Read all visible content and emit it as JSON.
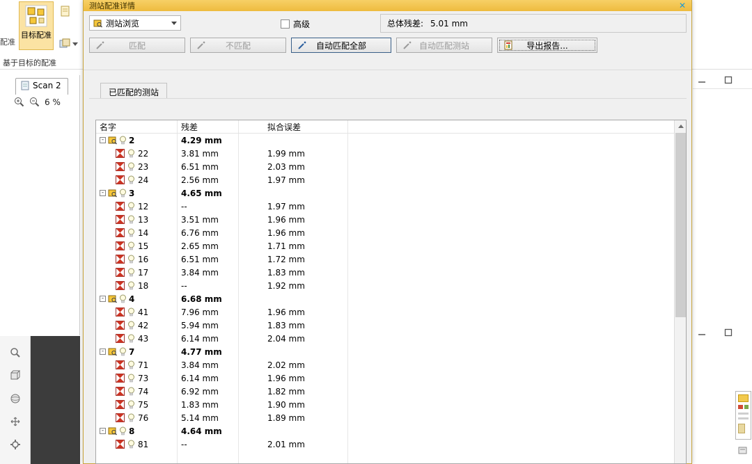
{
  "app": {
    "toolbar": {
      "partial_label": "配准",
      "target_registration_label": "目标配准",
      "target_based_label": "基于目标的配准"
    },
    "left_panel": {
      "tab_label": "Scan 2",
      "zoom_value": "6 %"
    }
  },
  "dialog": {
    "title": "测站配准详情",
    "close_glyph": "✕",
    "station_view_dropdown": "测站浏览",
    "advanced_label": "高级",
    "overall_residual_label": "总体残差:",
    "overall_residual_value": "5.01 mm",
    "buttons": {
      "match": "匹配",
      "unmatch": "不匹配",
      "auto_match_all": "自动匹配全部",
      "auto_match_station": "自动匹配测站",
      "export_report": "导出报告..."
    },
    "section_tab": "已匹配的测站",
    "table": {
      "columns": [
        "名字",
        "残差",
        "拟合误差"
      ],
      "collapse_glyph": "-",
      "rows": [
        {
          "type": "group",
          "name": "2",
          "residual": "4.29 mm",
          "fit": ""
        },
        {
          "type": "item",
          "name": "22",
          "residual": "3.81 mm",
          "fit": "1.99 mm"
        },
        {
          "type": "item",
          "name": "23",
          "residual": "6.51 mm",
          "fit": "2.03 mm"
        },
        {
          "type": "item",
          "name": "24",
          "residual": "2.56 mm",
          "fit": "1.97 mm"
        },
        {
          "type": "group",
          "name": "3",
          "residual": "4.65 mm",
          "fit": ""
        },
        {
          "type": "item",
          "name": "12",
          "residual": "--",
          "fit": "1.97 mm"
        },
        {
          "type": "item",
          "name": "13",
          "residual": "3.51 mm",
          "fit": "1.96 mm"
        },
        {
          "type": "item",
          "name": "14",
          "residual": "6.76 mm",
          "fit": "1.96 mm"
        },
        {
          "type": "item",
          "name": "15",
          "residual": "2.65 mm",
          "fit": "1.71 mm"
        },
        {
          "type": "item",
          "name": "16",
          "residual": "6.51 mm",
          "fit": "1.72 mm"
        },
        {
          "type": "item",
          "name": "17",
          "residual": "3.84 mm",
          "fit": "1.83 mm"
        },
        {
          "type": "item",
          "name": "18",
          "residual": "--",
          "fit": "1.92 mm"
        },
        {
          "type": "group",
          "name": "4",
          "residual": "6.68 mm",
          "fit": ""
        },
        {
          "type": "item",
          "name": "41",
          "residual": "7.96 mm",
          "fit": "1.96 mm"
        },
        {
          "type": "item",
          "name": "42",
          "residual": "5.94 mm",
          "fit": "1.83 mm"
        },
        {
          "type": "item",
          "name": "43",
          "residual": "6.14 mm",
          "fit": "2.04 mm"
        },
        {
          "type": "group",
          "name": "7",
          "residual": "4.77 mm",
          "fit": ""
        },
        {
          "type": "item",
          "name": "71",
          "residual": "3.84 mm",
          "fit": "2.02 mm"
        },
        {
          "type": "item",
          "name": "73",
          "residual": "6.14 mm",
          "fit": "1.96 mm"
        },
        {
          "type": "item",
          "name": "74",
          "residual": "6.92 mm",
          "fit": "1.82 mm"
        },
        {
          "type": "item",
          "name": "75",
          "residual": "1.83 mm",
          "fit": "1.90 mm"
        },
        {
          "type": "item",
          "name": "76",
          "residual": "5.14 mm",
          "fit": "1.89 mm"
        },
        {
          "type": "group",
          "name": "8",
          "residual": "4.64 mm",
          "fit": ""
        },
        {
          "type": "item",
          "name": "81",
          "residual": "--",
          "fit": "2.01 mm"
        }
      ]
    }
  },
  "colors": {
    "title_bar": "#eebb3e",
    "highlight_button_border": "#3a5f88",
    "target_icon_red": "#cc3322",
    "station_icon_yellow": "#f6c73a"
  }
}
